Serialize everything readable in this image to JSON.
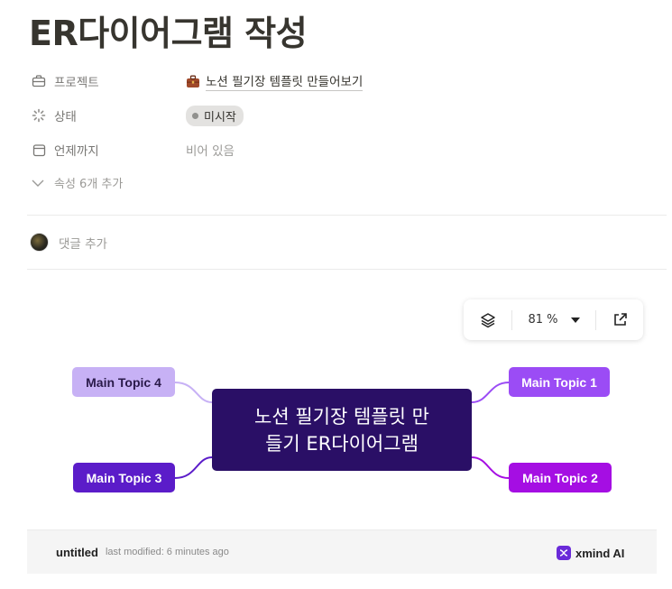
{
  "page": {
    "title": "ER다이어그램 작성"
  },
  "properties": [
    {
      "label": "프로젝트",
      "icon": "briefcase-icon",
      "value": "노션 필기장 템플릿 만들어보기",
      "type": "relation"
    },
    {
      "label": "상태",
      "icon": "status-spinner-icon",
      "value": "미시작",
      "type": "status"
    },
    {
      "label": "언제까지",
      "icon": "calendar-icon",
      "value": "비어 있음",
      "type": "empty"
    }
  ],
  "more_properties": "속성 6개 추가",
  "comment": {
    "placeholder": "댓글 추가"
  },
  "embed": {
    "zoom": "81 %",
    "mindmap": {
      "central": {
        "line1": "노션 필기장 템플릿 만",
        "line2": "들기 ER다이어그램",
        "color": "#2a0f66"
      },
      "topics": [
        {
          "label": "Main Topic 1",
          "bg": "#9b4cf5",
          "fg": "#ffffff"
        },
        {
          "label": "Main Topic 2",
          "bg": "#a50ee3",
          "fg": "#ffffff"
        },
        {
          "label": "Main Topic 3",
          "bg": "#5b1cc9",
          "fg": "#ffffff"
        },
        {
          "label": "Main Topic 4",
          "bg": "#c7b1f5",
          "fg": "#2a1a4a"
        }
      ]
    },
    "footer": {
      "file_name": "untitled",
      "last_modified": "last modified: 6 minutes ago",
      "brand": "xmind AI"
    }
  },
  "colors": {
    "text": "#37352f",
    "muted": "#787774",
    "accent": "#6a2bd9"
  }
}
